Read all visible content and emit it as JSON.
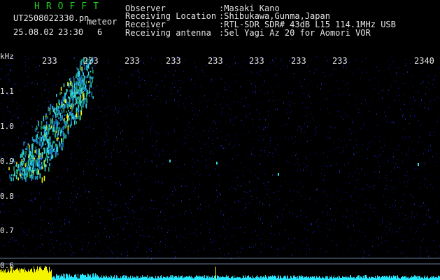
{
  "app_title": "HROFFT",
  "file": {
    "filename": "UT2508022330.pn",
    "type_label": "meteor",
    "date": "25.08.02",
    "time": "23:30",
    "count": "6"
  },
  "info": {
    "labels": [
      "Observer",
      "Receiving Location",
      "Receiver",
      "Receiving antenna"
    ],
    "values": [
      ":Masaki Kano",
      ":Shibukawa,Gunma,Japan",
      ":RTL-SDR SDR# 43dB L15 114.1MHz USB",
      ":5el Yagi Az 20 for Aomori VOR"
    ]
  },
  "y_axis": {
    "unit": "kHz",
    "ticks": [
      "1.1",
      "1.0",
      "0.9",
      "0.8",
      "0.7",
      "0.6"
    ]
  },
  "x_axis": {
    "ticks": [
      "233",
      "233",
      "233",
      "233",
      "233",
      "233",
      "233",
      "233",
      "2340"
    ]
  },
  "colors": {
    "background": "#000000",
    "noise": "#0a0f6e",
    "trail_cyan": "#31d7e6",
    "trail_yellow": "#f4f400",
    "bottom_signal": "#26e8ff",
    "axis_text": "#e6e6e6",
    "title_green": "#1fd21f"
  }
}
